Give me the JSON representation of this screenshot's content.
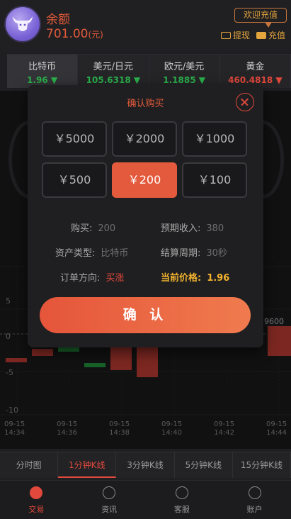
{
  "header": {
    "balance_label": "余额",
    "balance_value": "701.00",
    "currency_unit": "(元)",
    "welcome": "欢迎充值",
    "withdraw": "提现",
    "recharge": "充值"
  },
  "tickers": [
    {
      "name": "比特币",
      "price": "1.96",
      "direction": "up"
    },
    {
      "name": "美元/日元",
      "price": "105.6318",
      "direction": "up"
    },
    {
      "name": "欧元/美元",
      "price": "1.1885",
      "direction": "up"
    },
    {
      "name": "黄金",
      "price": "460.4818",
      "direction": "down"
    }
  ],
  "chart": {
    "y_ticks": [
      "5",
      "0",
      "-5",
      "-10"
    ],
    "x_ticks": [
      {
        "date": "09-15",
        "time": "14:34"
      },
      {
        "date": "09-15",
        "time": "14:36"
      },
      {
        "date": "09-15",
        "time": "14:38"
      },
      {
        "date": "09-15",
        "time": "14:40"
      },
      {
        "date": "09-15",
        "time": "14:42"
      },
      {
        "date": "09-15",
        "time": "14:44"
      }
    ],
    "last_price_fragment": "9600"
  },
  "tabs": [
    "分时图",
    "1分钟K线",
    "3分钟K线",
    "5分钟K线",
    "15分钟K线"
  ],
  "active_tab": 1,
  "nav": [
    "交易",
    "资讯",
    "客服",
    "账户"
  ],
  "modal": {
    "title": "确认购买",
    "amounts": [
      "￥5000",
      "￥2000",
      "￥1000",
      "￥500",
      "￥200",
      "￥100"
    ],
    "selected_amount_index": 4,
    "buy_label": "购买:",
    "buy_value": "200",
    "income_label": "预期收入:",
    "income_value": "380",
    "asset_label": "资产类型:",
    "asset_value": "比特币",
    "period_label": "结算周期:",
    "period_value": "30秒",
    "direction_label": "订单方向:",
    "direction_value": "买涨",
    "current_price_label": "当前价格:",
    "current_price_value": "1.96",
    "confirm": "确 认"
  },
  "colors": {
    "accent_red": "#e2483c",
    "gold": "#f2b22e",
    "up_green": "#2bb24c"
  }
}
